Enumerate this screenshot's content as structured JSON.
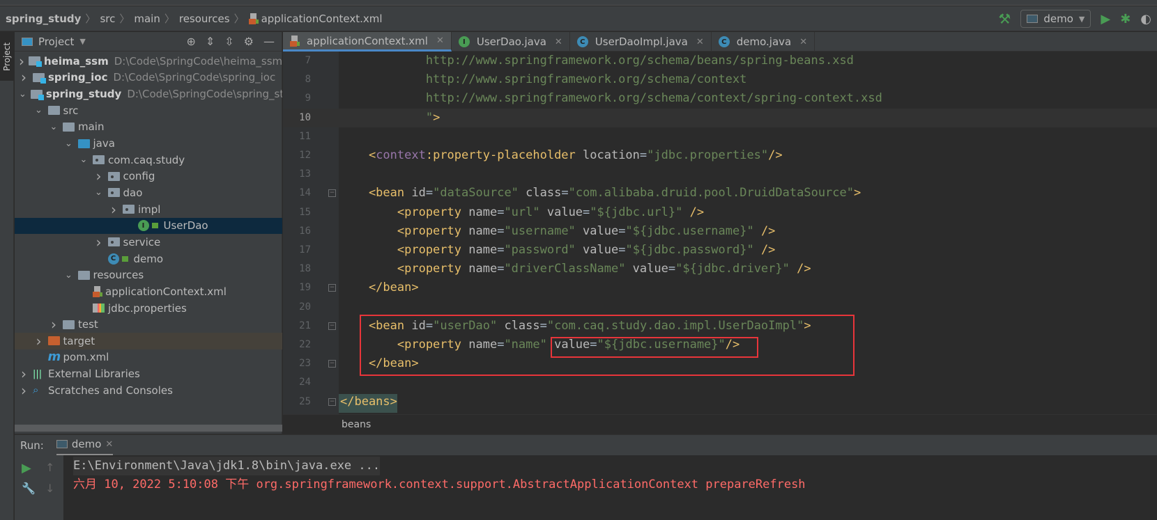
{
  "breadcrumb": [
    "spring_study",
    "src",
    "main",
    "resources",
    "applicationContext.xml"
  ],
  "run_config": "demo",
  "colors": {
    "accent": "#4a88c7",
    "tag": "#e8bf6a",
    "attr": "#bababa",
    "value": "#6a8759",
    "namespace": "#9876aa",
    "highlight_box": "#e8353a",
    "error_text": "#ff6b68",
    "run_green": "#499c54"
  },
  "left_tool": {
    "project_tab": "Project"
  },
  "project": {
    "title": "Project",
    "tree": [
      {
        "d": 0,
        "arrow": "right",
        "icon": "module",
        "label": "heima_ssm",
        "path": "D:\\Code\\SpringCode\\heima_ssm",
        "bold": true
      },
      {
        "d": 0,
        "arrow": "right",
        "icon": "module",
        "label": "spring_ioc",
        "path": "D:\\Code\\SpringCode\\spring_ioc",
        "bold": true
      },
      {
        "d": 0,
        "arrow": "down",
        "icon": "module",
        "label": "spring_study",
        "path": "D:\\Code\\SpringCode\\spring_study",
        "bold": true
      },
      {
        "d": 1,
        "arrow": "down",
        "icon": "folder",
        "label": "src"
      },
      {
        "d": 2,
        "arrow": "down",
        "icon": "folder",
        "label": "main"
      },
      {
        "d": 3,
        "arrow": "down",
        "icon": "source",
        "label": "java"
      },
      {
        "d": 4,
        "arrow": "down",
        "icon": "package",
        "label": "com.caq.study"
      },
      {
        "d": 5,
        "arrow": "right",
        "icon": "package",
        "label": "config"
      },
      {
        "d": 5,
        "arrow": "down",
        "icon": "package",
        "label": "dao"
      },
      {
        "d": 6,
        "arrow": "right",
        "icon": "package",
        "label": "impl"
      },
      {
        "d": 7,
        "arrow": "none",
        "icon": "interface",
        "label": "UserDao",
        "selected": true
      },
      {
        "d": 5,
        "arrow": "right",
        "icon": "package",
        "label": "service"
      },
      {
        "d": 5,
        "arrow": "none",
        "icon": "class-run",
        "label": "demo"
      },
      {
        "d": 3,
        "arrow": "down",
        "icon": "resources",
        "label": "resources"
      },
      {
        "d": 4,
        "arrow": "none",
        "icon": "xml",
        "label": "applicationContext.xml"
      },
      {
        "d": 4,
        "arrow": "none",
        "icon": "properties",
        "label": "jdbc.properties"
      },
      {
        "d": 2,
        "arrow": "right",
        "icon": "folder",
        "label": "test"
      },
      {
        "d": 1,
        "arrow": "right",
        "icon": "excluded",
        "label": "target",
        "highlighted": true
      },
      {
        "d": 1,
        "arrow": "none",
        "icon": "maven",
        "label": "pom.xml"
      },
      {
        "d": 0,
        "arrow": "right",
        "icon": "libraries",
        "label": "External Libraries"
      },
      {
        "d": 0,
        "arrow": "right",
        "icon": "scratches",
        "label": "Scratches and Consoles"
      }
    ]
  },
  "tabs": [
    {
      "label": "applicationContext.xml",
      "icon": "xml",
      "active": true
    },
    {
      "label": "UserDao.java",
      "icon": "interface"
    },
    {
      "label": "UserDaoImpl.java",
      "icon": "class"
    },
    {
      "label": "demo.java",
      "icon": "class"
    }
  ],
  "editor": {
    "current_line": 10,
    "lines": [
      {
        "n": 7,
        "tokens": [
          [
            "v",
            "            http://www.springframework.org/schema/beans/spring-beans.xsd"
          ]
        ]
      },
      {
        "n": 8,
        "tokens": [
          [
            "v",
            "            http://www.springframework.org/schema/context"
          ]
        ]
      },
      {
        "n": 9,
        "tokens": [
          [
            "v",
            "            http://www.springframework.org/schema/context/spring-context.xsd"
          ]
        ]
      },
      {
        "n": 10,
        "tokens": [
          [
            "v",
            "            \""
          ],
          [
            "t",
            ">"
          ]
        ]
      },
      {
        "n": 11,
        "tokens": []
      },
      {
        "n": 12,
        "tokens": [
          [
            "t",
            "    <"
          ],
          [
            "n",
            "context"
          ],
          [
            "t",
            ":property-placeholder "
          ],
          [
            "a",
            "location"
          ],
          [
            "p",
            "="
          ],
          [
            "v",
            "\"jdbc.properties\""
          ],
          [
            "t",
            "/>"
          ]
        ]
      },
      {
        "n": 13,
        "tokens": []
      },
      {
        "n": 14,
        "tokens": [
          [
            "t",
            "    <bean "
          ],
          [
            "a",
            "id"
          ],
          [
            "p",
            "="
          ],
          [
            "v",
            "\"dataSource\" "
          ],
          [
            "a",
            "class"
          ],
          [
            "p",
            "="
          ],
          [
            "v",
            "\"com.alibaba.druid.pool.DruidDataSource\""
          ],
          [
            "t",
            ">"
          ]
        ]
      },
      {
        "n": 15,
        "tokens": [
          [
            "t",
            "        <property "
          ],
          [
            "a",
            "name"
          ],
          [
            "p",
            "="
          ],
          [
            "v",
            "\"url\" "
          ],
          [
            "a",
            "value"
          ],
          [
            "p",
            "="
          ],
          [
            "v",
            "\"${jdbc.url}\" "
          ],
          [
            "t",
            "/>"
          ]
        ]
      },
      {
        "n": 16,
        "tokens": [
          [
            "t",
            "        <property "
          ],
          [
            "a",
            "name"
          ],
          [
            "p",
            "="
          ],
          [
            "v",
            "\"username\" "
          ],
          [
            "a",
            "value"
          ],
          [
            "p",
            "="
          ],
          [
            "v",
            "\"${jdbc.username}\" "
          ],
          [
            "t",
            "/>"
          ]
        ]
      },
      {
        "n": 17,
        "tokens": [
          [
            "t",
            "        <property "
          ],
          [
            "a",
            "name"
          ],
          [
            "p",
            "="
          ],
          [
            "v",
            "\"password\" "
          ],
          [
            "a",
            "value"
          ],
          [
            "p",
            "="
          ],
          [
            "v",
            "\"${jdbc.password}\" "
          ],
          [
            "t",
            "/>"
          ]
        ]
      },
      {
        "n": 18,
        "tokens": [
          [
            "t",
            "        <property "
          ],
          [
            "a",
            "name"
          ],
          [
            "p",
            "="
          ],
          [
            "v",
            "\"driverClassName\" "
          ],
          [
            "a",
            "value"
          ],
          [
            "p",
            "="
          ],
          [
            "v",
            "\"${jdbc.driver}\" "
          ],
          [
            "t",
            "/>"
          ]
        ]
      },
      {
        "n": 19,
        "tokens": [
          [
            "t",
            "    </bean>"
          ]
        ]
      },
      {
        "n": 20,
        "tokens": []
      },
      {
        "n": 21,
        "tokens": [
          [
            "t",
            "    <bean "
          ],
          [
            "a",
            "id"
          ],
          [
            "p",
            "="
          ],
          [
            "v",
            "\"userDao\" "
          ],
          [
            "a",
            "class"
          ],
          [
            "p",
            "="
          ],
          [
            "v",
            "\"com.caq.study.dao.impl.UserDaoImpl\""
          ],
          [
            "t",
            ">"
          ]
        ]
      },
      {
        "n": 22,
        "tokens": [
          [
            "t",
            "        <property "
          ],
          [
            "a",
            "name"
          ],
          [
            "p",
            "="
          ],
          [
            "v",
            "\"name\" "
          ],
          [
            "a",
            "value"
          ],
          [
            "p",
            "="
          ],
          [
            "v",
            "\"${jdbc.username}\""
          ],
          [
            "t",
            "/>"
          ]
        ]
      },
      {
        "n": 23,
        "tokens": [
          [
            "t",
            "    </bean>"
          ]
        ]
      },
      {
        "n": 24,
        "tokens": []
      },
      {
        "n": 25,
        "tokens": [
          [
            "t",
            "</beans>"
          ]
        ]
      }
    ],
    "fold_lines": [
      14,
      19,
      21,
      23,
      25
    ],
    "breadcrumb": "beans"
  },
  "run": {
    "label": "Run:",
    "tab": "demo",
    "console": [
      {
        "text": "E:\\Environment\\Java\\jdk1.8\\bin\\java.exe ...",
        "kind": "cmd"
      },
      {
        "text": "六月 10, 2022 5:10:08 下午 org.springframework.context.support.AbstractApplicationContext prepareRefresh",
        "kind": "err"
      }
    ]
  }
}
